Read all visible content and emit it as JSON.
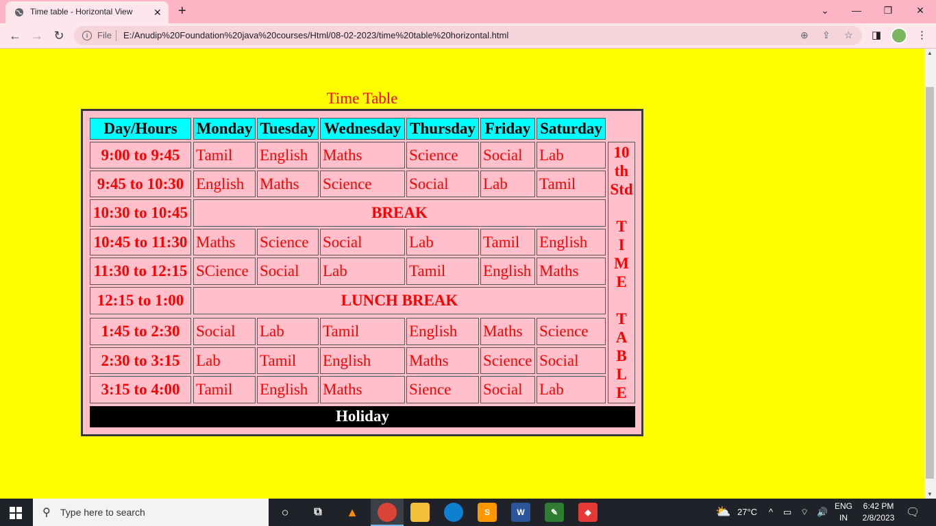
{
  "browser": {
    "tab_title": "Time table - Horizontal View",
    "close_glyph": "✕",
    "new_tab_glyph": "+",
    "scheme_label": "File",
    "url": "E:/Anudip%20Foundation%20java%20courses/Html/08-02-2023/time%20table%20horizontal.html",
    "icons": [
      "back-icon",
      "forward-icon",
      "reload-icon",
      "info-icon",
      "zoom-icon",
      "share-icon",
      "star-icon",
      "side-panel-icon",
      "profile-avatar"
    ]
  },
  "page": {
    "caption": "Time Table",
    "headers": [
      "Day/Hours",
      "Monday",
      "Tuesday",
      "Wednesday",
      "Thursday",
      "Friday",
      "Saturday"
    ],
    "rows": [
      {
        "time": "9:00 to 9:45",
        "subjects": [
          "Tamil",
          "English",
          "Maths",
          "Science",
          "Social",
          "Lab"
        ]
      },
      {
        "time": "9:45 to 10:30",
        "subjects": [
          "English",
          "Maths",
          "Science",
          "Social",
          "Lab",
          "Tamil"
        ]
      },
      {
        "time": "10:30 to 10:45",
        "break": "BREAK"
      },
      {
        "time": "10:45 to 11:30",
        "subjects": [
          "Maths",
          "Science",
          "Social",
          "Lab",
          "Tamil",
          "English"
        ]
      },
      {
        "time": "11:30 to 12:15",
        "subjects": [
          "SCience",
          "Social",
          "Lab",
          "Tamil",
          "English",
          "Maths"
        ]
      },
      {
        "time": "12:15 to 1:00",
        "break": "LUNCH BREAK"
      },
      {
        "time": "1:45 to 2:30",
        "subjects": [
          "Social",
          "Lab",
          "Tamil",
          "English",
          "Maths",
          "Science"
        ]
      },
      {
        "time": "2:30 to 3:15",
        "subjects": [
          "Lab",
          "Tamil",
          "English",
          "Maths",
          "Science",
          "Social"
        ]
      },
      {
        "time": "3:15 to 4:00",
        "subjects": [
          "Tamil",
          "English",
          "Maths",
          "Sience",
          "Social",
          "Lab"
        ]
      }
    ],
    "side_label": [
      "10",
      "th",
      "Std",
      "",
      "T",
      "I",
      "M",
      "E",
      "",
      "T",
      "A",
      "B",
      "L",
      "E"
    ],
    "footer": "Holiday",
    "colors": {
      "page_bg": "#ffff00",
      "table_bg": "#ffc0cb",
      "header_bg": "#00ffff",
      "text": "#ff0000",
      "footer_bg": "#000000"
    }
  },
  "taskbar": {
    "search_placeholder": "Type here to search",
    "weather": "27°C",
    "lang_1": "ENG",
    "lang_2": "IN",
    "time": "6:42 PM",
    "date": "2/8/2023"
  }
}
